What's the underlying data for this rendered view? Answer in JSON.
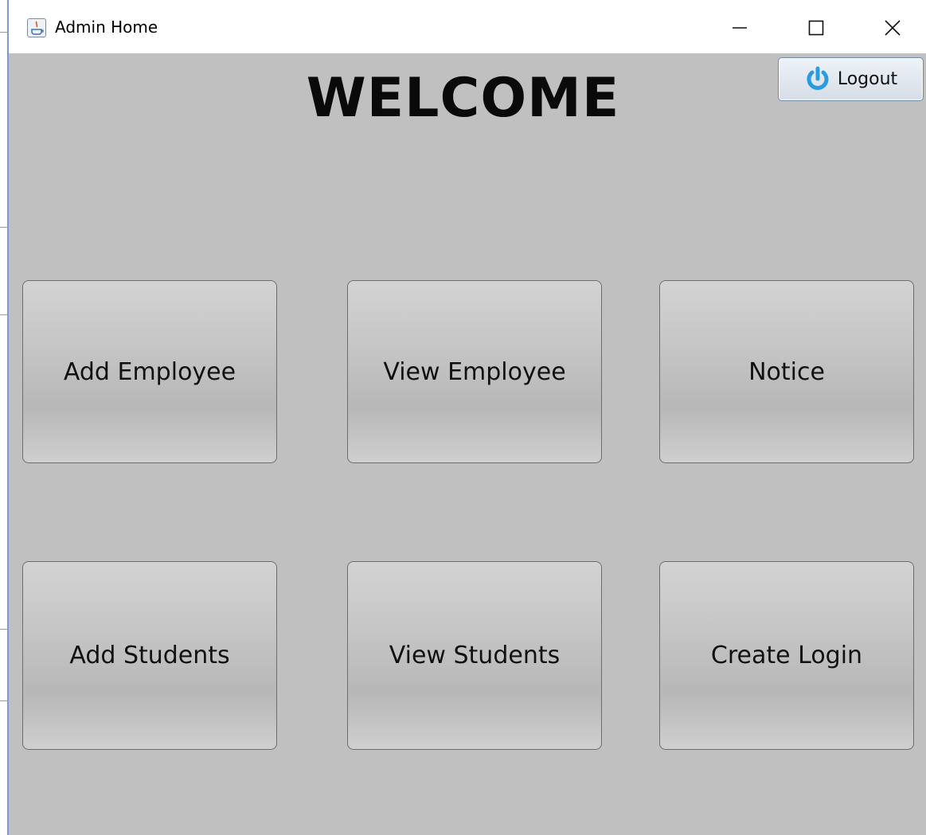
{
  "window": {
    "title": "Admin Home",
    "minimize_icon": "minimize-icon",
    "maximize_icon": "maximize-icon",
    "close_icon": "close-icon",
    "app_icon": "java-app-icon"
  },
  "header": {
    "welcome": "WELCOME",
    "logout_label": "Logout",
    "logout_icon": "power-icon",
    "logout_icon_color": "#2b9be0"
  },
  "tiles": [
    {
      "label": "Add Employee"
    },
    {
      "label": "View Employee"
    },
    {
      "label": "Notice"
    },
    {
      "label": "Add Students"
    },
    {
      "label": "View Students"
    },
    {
      "label": "Create Login"
    }
  ],
  "colors": {
    "background": "#c0c0c0",
    "titlebar": "#ffffff"
  }
}
